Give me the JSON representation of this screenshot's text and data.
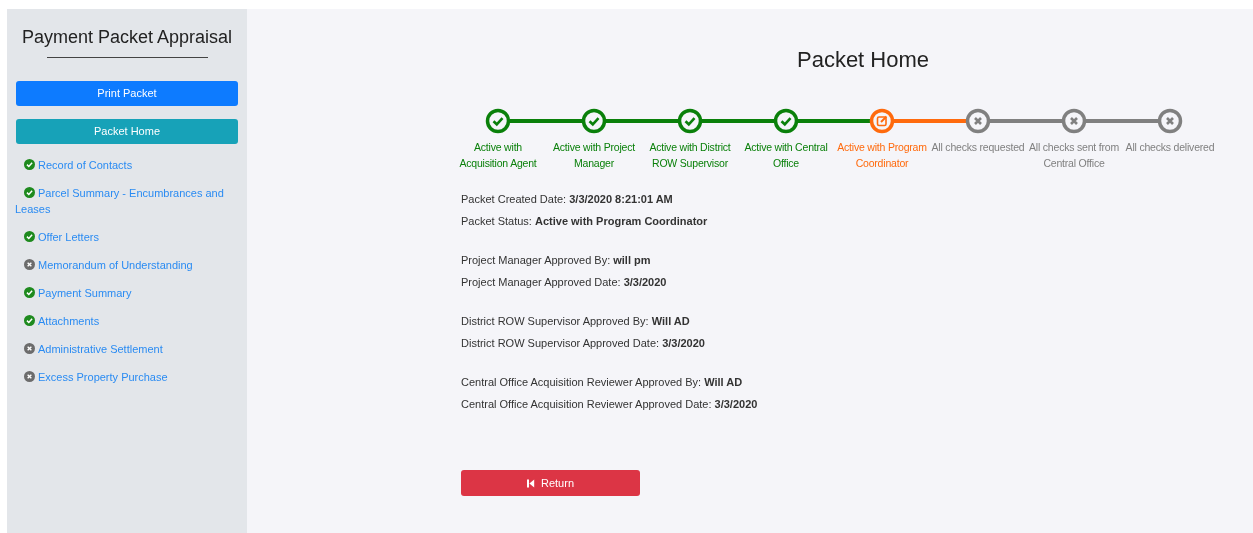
{
  "sidebar": {
    "title": "Payment Packet Appraisal",
    "buttons": [
      {
        "label": "Print Packet",
        "kind": "primary"
      },
      {
        "label": "Packet Home",
        "kind": "info"
      }
    ],
    "items": [
      {
        "label": "Record of Contacts",
        "complete": true
      },
      {
        "label": "Parcel Summary - Encumbrances and Leases",
        "complete": true
      },
      {
        "label": "Offer Letters",
        "complete": true
      },
      {
        "label": "Memorandum of Understanding",
        "complete": false
      },
      {
        "label": "Payment Summary",
        "complete": true
      },
      {
        "label": "Attachments",
        "complete": true
      },
      {
        "label": "Administrative Settlement",
        "complete": false
      },
      {
        "label": "Excess Property Purchase",
        "complete": false
      }
    ]
  },
  "main": {
    "title": "Packet Home",
    "steps": [
      {
        "label": "Active with Acquisition Agent",
        "kind": "done"
      },
      {
        "label": "Active with Project Manager",
        "kind": "done"
      },
      {
        "label": "Active with District ROW Supervisor",
        "kind": "done"
      },
      {
        "label": "Active with Central Office",
        "kind": "done"
      },
      {
        "label": "Active with Program Coordinator",
        "kind": "current"
      },
      {
        "label": "All checks requested",
        "kind": "pending"
      },
      {
        "label": "All checks sent from Central Office",
        "kind": "pending"
      },
      {
        "label": "All checks delivered",
        "kind": "pending"
      }
    ],
    "details": [
      [
        "Packet Created Date: **3/3/2020 8:21:01 AM**",
        "Packet Status: **Active with Program Coordinator**"
      ],
      [
        "Project Manager Approved By: **will pm**",
        "Project Manager Approved Date: **3/3/2020**"
      ],
      [
        "District ROW Supervisor Approved By: **Will AD**",
        "District ROW Supervisor Approved Date: **3/3/2020**"
      ],
      [
        "Central Office Acquisition Reviewer Approved By: **Will AD**",
        "Central Office Acquisition Reviewer Approved Date: **3/3/2020**"
      ]
    ],
    "return_button": {
      "label": "Return"
    }
  }
}
